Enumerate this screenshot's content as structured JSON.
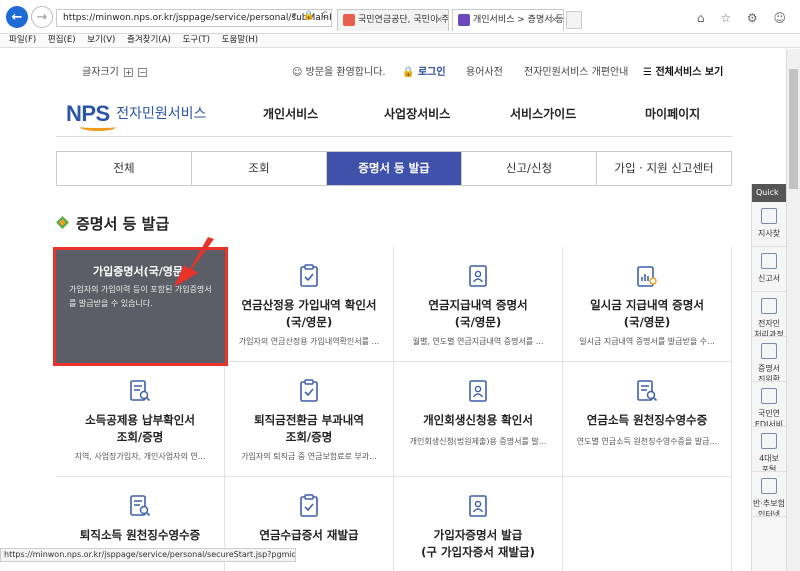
{
  "browser": {
    "address": "https://minwon.nps.or.kr/jsppage/service/personal/subMainPage.jsp",
    "address_icons": "▾ 🔒 C",
    "tabs": [
      {
        "label": "국민연금공단, 국민이 주인인 ...",
        "close": "×"
      },
      {
        "label": "개인서비스 > 증명서 등 발...",
        "close": "×"
      }
    ],
    "window_icons": "⌂ ☆ ⚙ ☺",
    "menu": [
      "파일(F)",
      "편집(E)",
      "보기(V)",
      "즐겨찾기(A)",
      "도구(T)",
      "도움말(H)"
    ],
    "status_url": "https://minwon.nps.or.kr/jsppage/service/personal/secureStart.jsp?pgmid=npslogin_list"
  },
  "util": {
    "font_size_label": "글자크기",
    "font_plus": "+",
    "font_minus": "−",
    "welcome": "방문을 환영합니다.",
    "login": "로그인",
    "dictionary": "용어사전",
    "renewal": "전자민원서비스 개편안내",
    "all_services": "전체서비스 보기"
  },
  "logo": {
    "nps": "NPS",
    "service": "전자민원서비스"
  },
  "gnb": [
    "개인서비스",
    "사업장서비스",
    "서비스가이드",
    "마이페이지"
  ],
  "tabs": [
    "전체",
    "조회",
    "증명서 등 발급",
    "신고/신청",
    "가입 · 지원 신고센터"
  ],
  "active_tab": 2,
  "section_title": "증명서 등 발급",
  "hover_card": {
    "name": "가입증명서(국/영문)",
    "desc": "가입자의 가입이력 등이 포함된 가입증명서를 발급받을 수 있습니다."
  },
  "services": [
    {
      "name": "",
      "desc": "",
      "icon": "document-check-icon"
    },
    {
      "name": "연금산정용 가입내역 확인서\n(국/영문)",
      "desc": "가입자의 연금산정용 가입내역확인서를 ...",
      "icon": "document-check-icon"
    },
    {
      "name": "연금지급내역 증명서\n(국/영문)",
      "desc": "월별, 연도별 연금지급내역 증명서를 ...",
      "icon": "person-document-icon"
    },
    {
      "name": "일시금 지급내역 증명서\n(국/영문)",
      "desc": "일시금 지급내역 증명서를 발급받을 수...",
      "icon": "chart-document-icon"
    },
    {
      "name": "소득공제용 납부확인서\n조회/증명",
      "desc": "지역, 사업장가입자, 개인사업자의 연...",
      "icon": "search-document-icon"
    },
    {
      "name": "퇴직금전환금 부과내역\n조회/증명",
      "desc": "가입자의 퇴직금 중 연금보험료로 부과...",
      "icon": "document-check-icon"
    },
    {
      "name": "개인회생신청용 확인서",
      "desc": "개인회생신청(법원제출)용 증명서를 발...",
      "icon": "person-document-icon"
    },
    {
      "name": "연금소득 원천징수영수증",
      "desc": "연도별 연금소득 원천징수영수증을 발급...",
      "icon": "search-document-icon"
    },
    {
      "name": "퇴직소득 원천징수영수증",
      "desc": "",
      "icon": "search-document-icon"
    },
    {
      "name": "연금수급증서 재발급",
      "desc": "",
      "icon": "document-check-icon"
    },
    {
      "name": "가입자증명서 발급\n(구 가입자증서 재발급)",
      "desc": "",
      "icon": "person-document-icon"
    },
    {
      "name": "",
      "desc": "",
      "icon": ""
    }
  ],
  "quick": {
    "header": "Quick",
    "items": [
      "지사찾",
      "신고서",
      "전자민\n처리과정",
      "증명서\n진위확",
      "국민연\nEDI서비\n(사업장)",
      "4대보\n포털",
      "반·추보험\n인터넷"
    ]
  }
}
